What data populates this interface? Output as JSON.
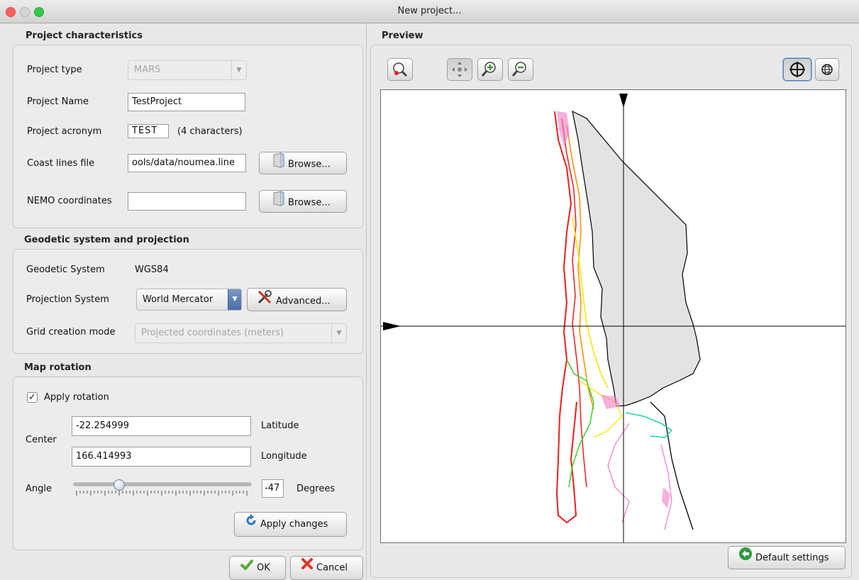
{
  "window": {
    "title": "New project..."
  },
  "sections": {
    "project_characteristics": "Project characteristics",
    "preview": "Preview",
    "geodetic": "Geodetic system and projection",
    "map_rotation": "Map rotation"
  },
  "project": {
    "type_label": "Project type",
    "type_value": "MARS",
    "name_label": "Project Name",
    "name_value": "TestProject",
    "acronym_label": "Project acronym",
    "acronym_value": "TEST",
    "acronym_hint": "(4 characters)",
    "coast_label": "Coast lines file",
    "coast_value": "ools/data/noumea.line",
    "nemo_label": "NEMO coordinates",
    "nemo_value": "",
    "browse_label": "Browse..."
  },
  "geodetic": {
    "system_label": "Geodetic System",
    "system_value": "WGS84",
    "projection_label": "Projection System",
    "projection_value": "World Mercator",
    "advanced_label": "Advanced...",
    "grid_mode_label": "Grid creation mode",
    "grid_mode_value": "Projected coordinates (meters)"
  },
  "rotation": {
    "apply_rotation_label": "Apply rotation",
    "apply_rotation_checked": true,
    "center_label": "Center",
    "latitude_value": "-22.254999",
    "latitude_label": "Latitude",
    "longitude_value": "166.414993",
    "longitude_label": "Longitude",
    "angle_label": "Angle",
    "angle_value": "-47",
    "degrees_label": "Degrees",
    "apply_changes_label": "Apply changes"
  },
  "footer": {
    "ok_label": "OK",
    "cancel_label": "Cancel"
  },
  "preview": {
    "default_settings_label": "Default settings"
  },
  "colors": {
    "land": "#e3e3e3",
    "coast": "#000000",
    "depth_red": "#e8201c",
    "depth_orange": "#ff8c00",
    "depth_yellow": "#f2e600",
    "depth_green": "#39d12c",
    "depth_cyan": "#19d6b0",
    "depth_pink": "#f27ac8"
  }
}
